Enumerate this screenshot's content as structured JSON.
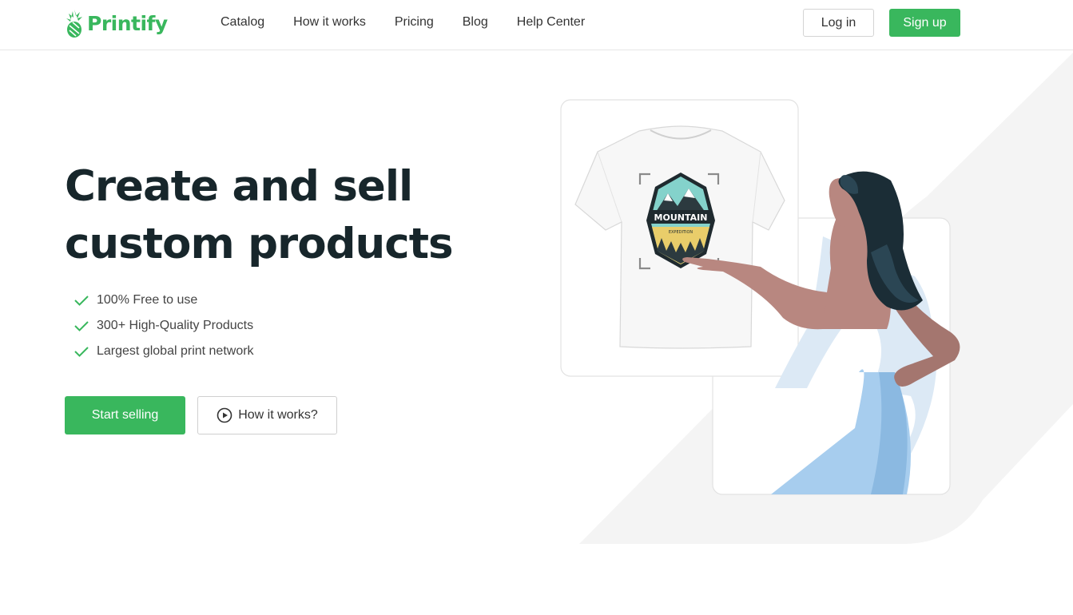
{
  "brand": {
    "name": "Printify",
    "color": "#39b75d"
  },
  "nav": {
    "items": [
      {
        "label": "Catalog"
      },
      {
        "label": "How it works"
      },
      {
        "label": "Pricing"
      },
      {
        "label": "Blog"
      },
      {
        "label": "Help Center"
      }
    ]
  },
  "header": {
    "login_label": "Log in",
    "signup_label": "Sign up"
  },
  "hero": {
    "title_line1": "Create and sell",
    "title_line2": "custom products",
    "features": [
      "100% Free to use",
      "300+ High-Quality Products",
      "Largest global print network"
    ],
    "start_label": "Start selling",
    "how_label": "How it works?"
  },
  "illustration": {
    "badge_text": "MOUNTAIN",
    "badge_subtext": "EXPEDITION",
    "icons": [
      "check-icon",
      "play-icon",
      "pineapple-logo-icon"
    ]
  }
}
